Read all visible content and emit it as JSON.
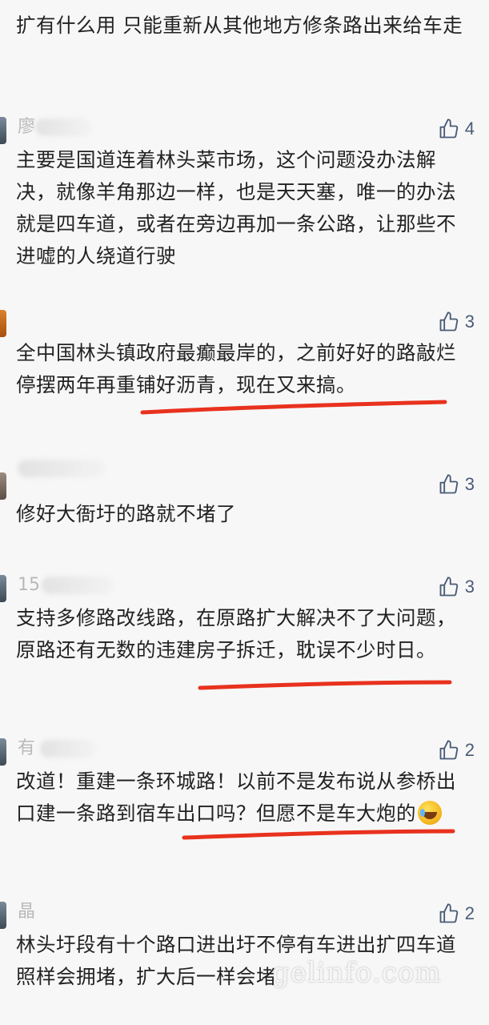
{
  "comments": [
    {
      "username": "",
      "likes": "",
      "text": "扩有什么用 只能重新从其他地方修条路出来给车走"
    },
    {
      "username": "廖",
      "likes": "4",
      "text": "主要是国道连着林头菜市场，这个问题没办法解决，就像羊角那边一样，也是天天塞，唯一的办法就是四车道，或者在旁边再加一条公路，让那些不进嘘的人绕道行驶"
    },
    {
      "username": "",
      "likes": "3",
      "text": "全中国林头镇政府最癫最岸的，之前好好的路敲烂停摆两年再重铺好沥青，现在又来搞。"
    },
    {
      "username": "",
      "likes": "3",
      "text": "修好大衙圩的路就不堵了"
    },
    {
      "username": "15",
      "likes": "3",
      "text": "支持多修路改线路，在原路扩大解决不了大问题，原路还有无数的违建房子拆迁，耽误不少时日。"
    },
    {
      "username": "有",
      "likes": "2",
      "text": "改道！重建一条环城路！以前不是发布说从参桥出口建一条路到宿车出口吗？但愿不是车大炮的"
    },
    {
      "username": "晶",
      "likes": "2",
      "text": "林头圩段有十个路口进出圩不停有车进出扩四车道照样会拥堵，扩大后一样会堵"
    }
  ],
  "watermark": "gelinfo.com",
  "colors": {
    "background": "#f7f7f7",
    "text": "#222222",
    "username": "#b9b9b9",
    "like_icon": "#4a5b78",
    "annotation_red": "#e8321e"
  },
  "icons": {
    "like": "thumbs-up-icon",
    "emoji": "laughing-crying-emoji-icon"
  }
}
